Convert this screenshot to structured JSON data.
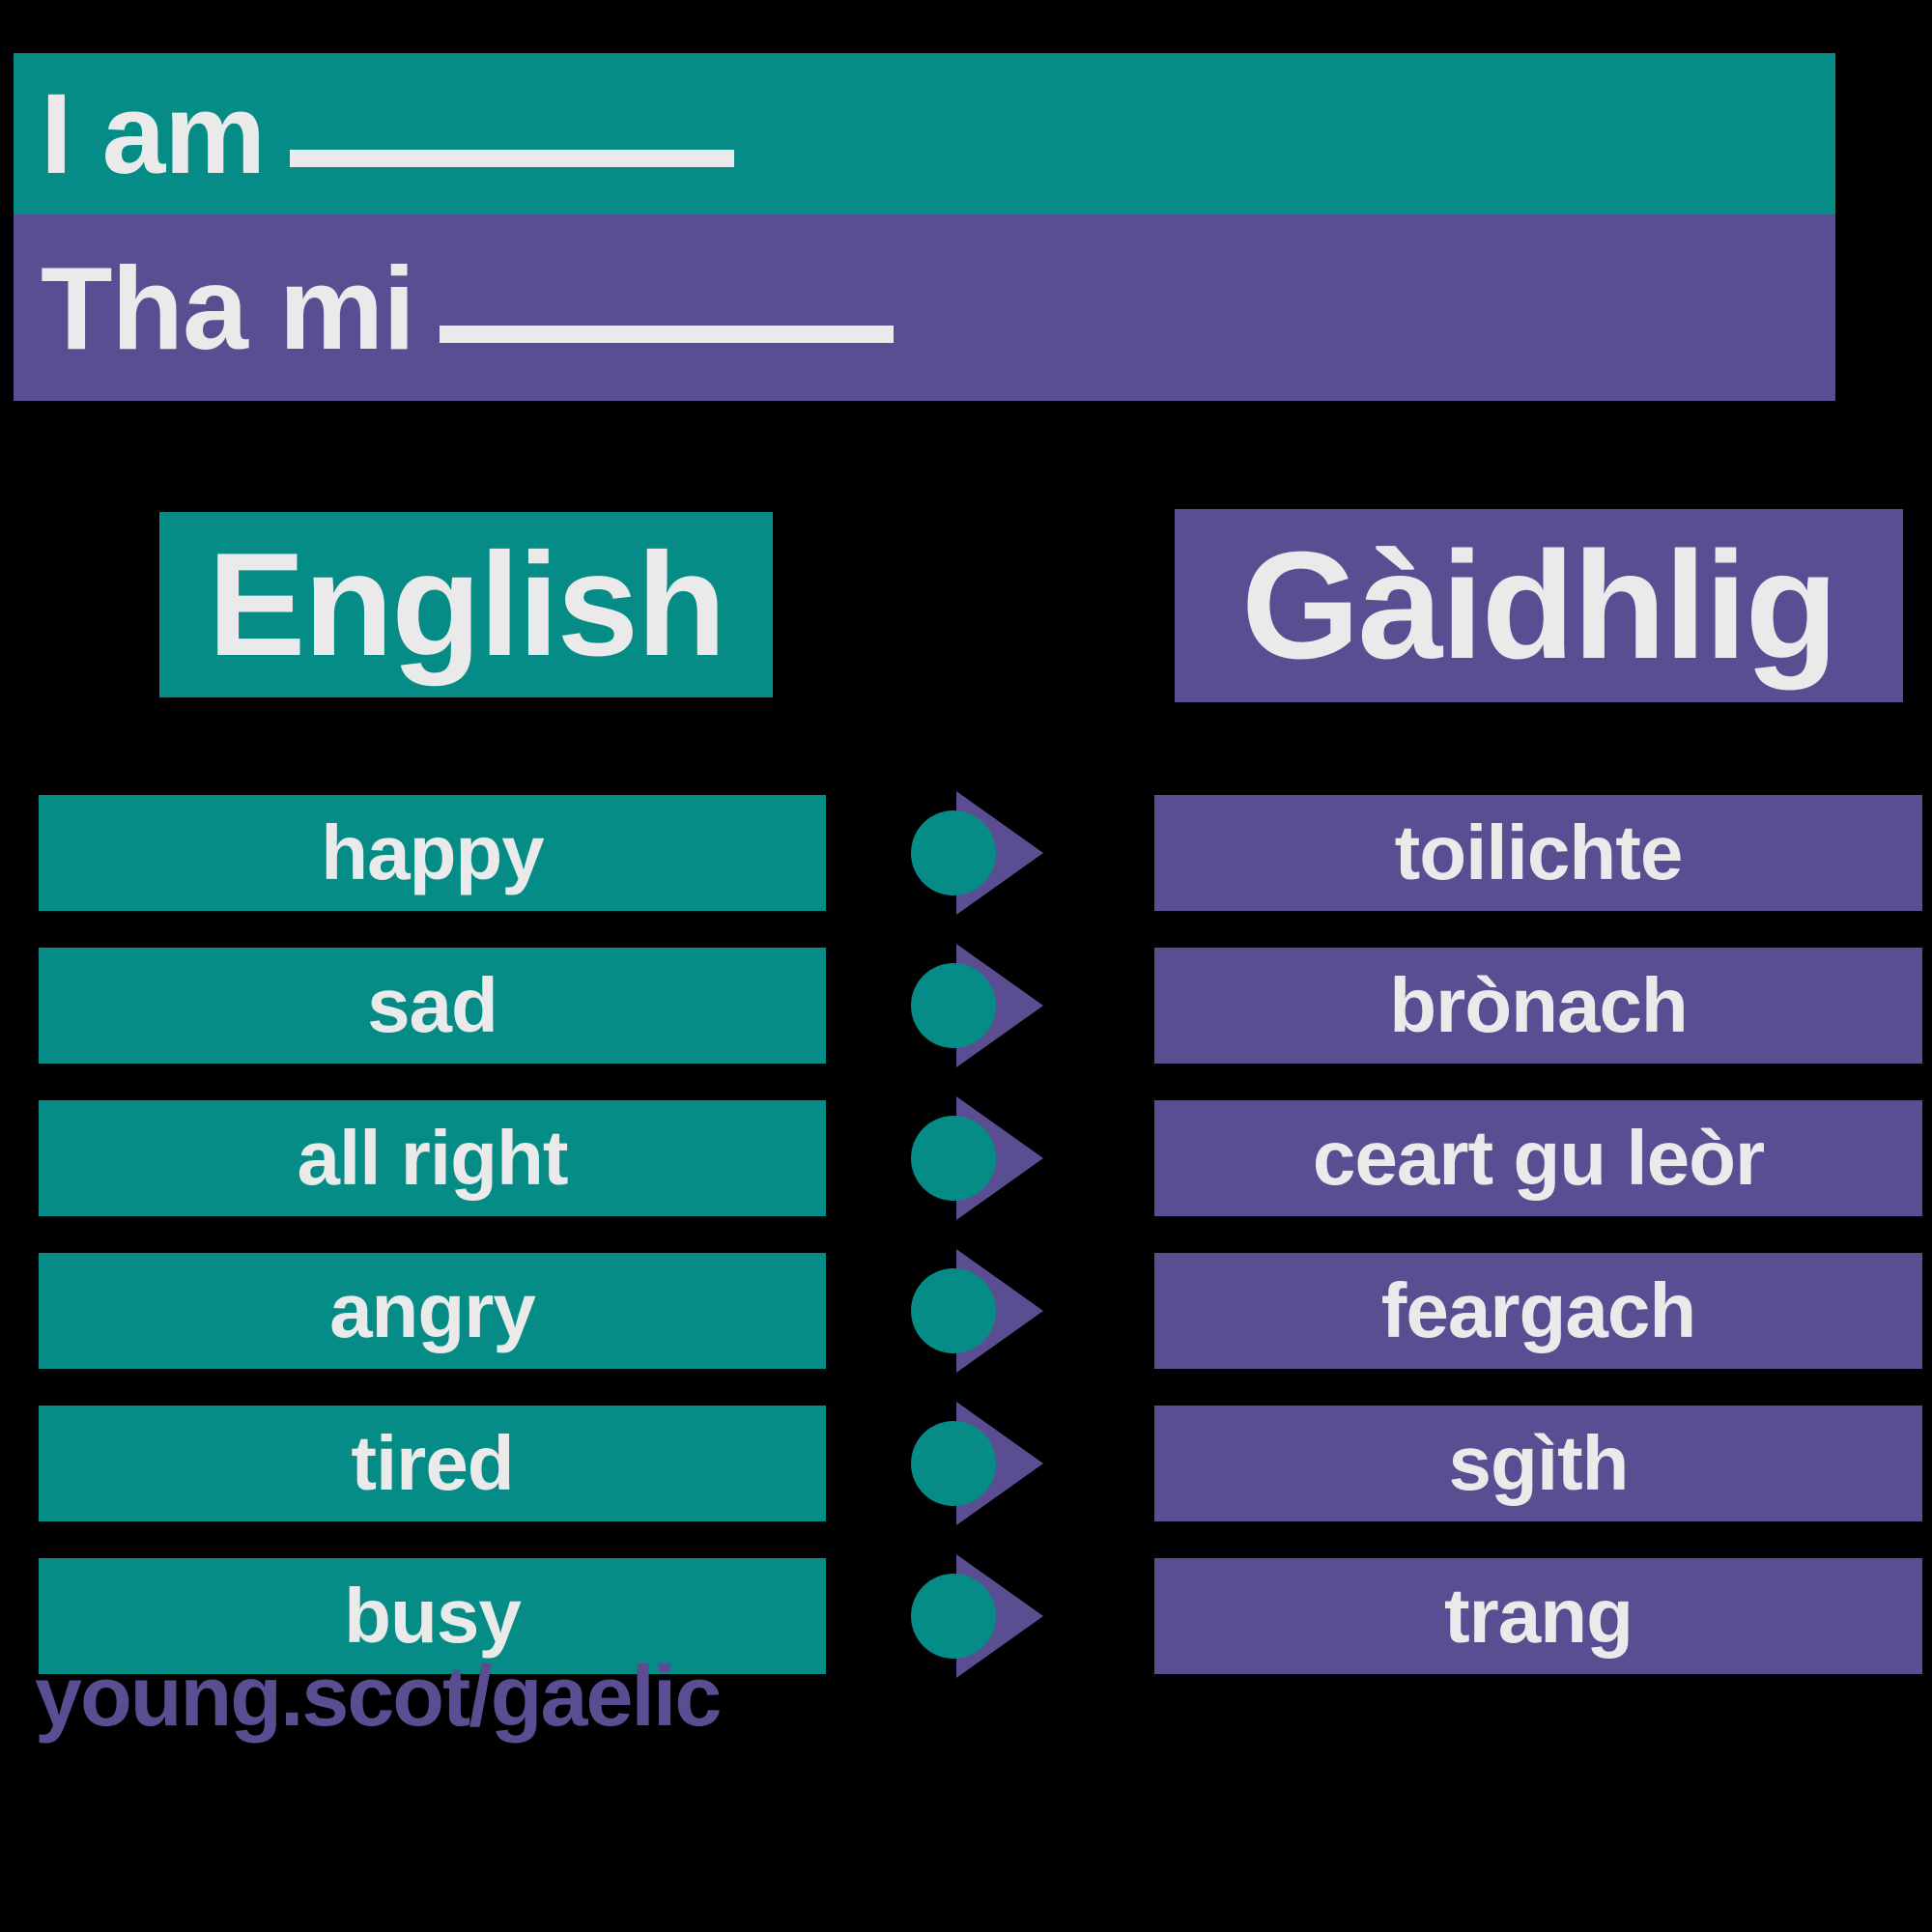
{
  "colors": {
    "background": "#000000",
    "teal": "#068C86",
    "purple": "#5B4D91",
    "text_light": "#EAEAEA"
  },
  "banners": {
    "english_phrase": "I am",
    "gaelic_phrase": "Tha mi"
  },
  "columns": {
    "english_header": "English",
    "gaidhlig_header": "Gàidhlig"
  },
  "rows": [
    {
      "english": "happy",
      "gaidhlig": "toilichte"
    },
    {
      "english": "sad",
      "gaidhlig": "brònach"
    },
    {
      "english": "all right",
      "gaidhlig": "ceart gu leòr"
    },
    {
      "english": "angry",
      "gaidhlig": "feargach"
    },
    {
      "english": "tired",
      "gaidhlig": "sgìth"
    },
    {
      "english": "busy",
      "gaidhlig": "trang"
    }
  ],
  "footer": {
    "url": "young.scot/gaelic"
  }
}
